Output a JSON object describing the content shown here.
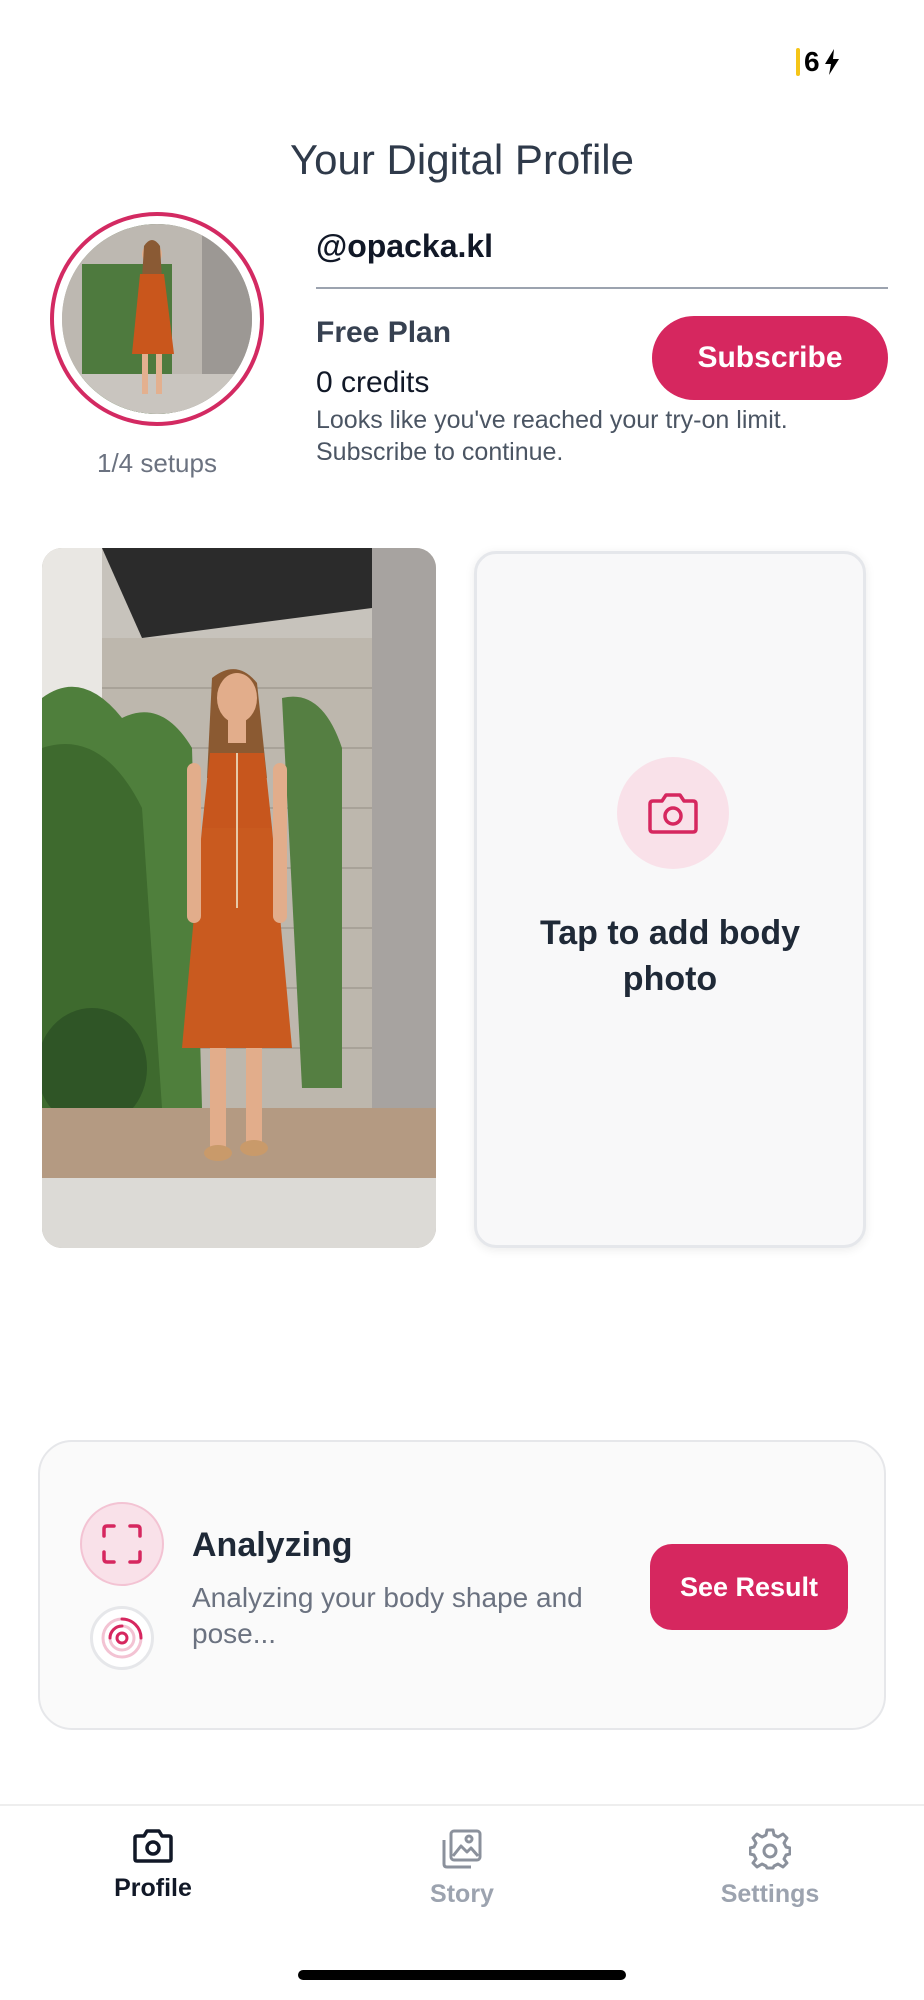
{
  "status_bar": {
    "battery": "6"
  },
  "header": {
    "title": "Your Digital Profile"
  },
  "profile": {
    "username": "@opacka.kl",
    "setups": "1/4 setups",
    "plan_name": "Free Plan",
    "credits": "0 credits",
    "limit_message": "Looks like you've reached your try-on limit. Subscribe to continue.",
    "subscribe_label": "Subscribe"
  },
  "photos": {
    "add_label": "Tap to add body photo"
  },
  "analysis": {
    "title": "Analyzing",
    "description": "Analyzing your body shape and pose...",
    "button_label": "See Result"
  },
  "tabs": [
    {
      "label": "Profile",
      "icon": "camera-icon",
      "active": true
    },
    {
      "label": "Story",
      "icon": "gallery-icon",
      "active": false
    },
    {
      "label": "Settings",
      "icon": "gear-icon",
      "active": false
    }
  ],
  "colors": {
    "accent": "#d6275f",
    "accent_light": "#f9e1e9",
    "text_dark": "#1f2937",
    "text_muted": "#6b7280"
  }
}
